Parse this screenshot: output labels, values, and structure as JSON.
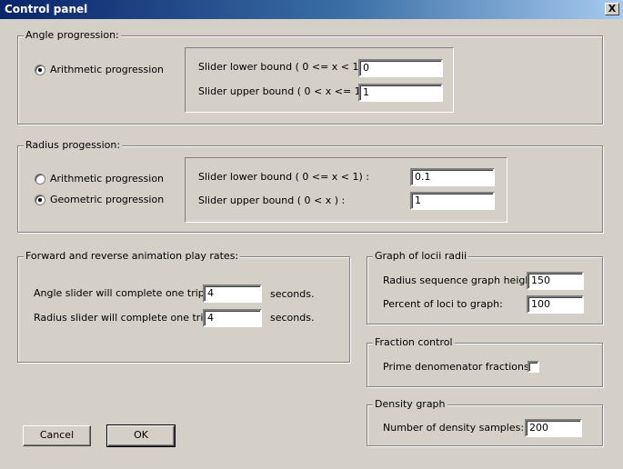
{
  "window": {
    "title": "Control panel",
    "close_label": "X"
  },
  "angle": {
    "legend": "Angle progression:",
    "radio_arith": "Arithmetic progression",
    "lower_label": "Slider lower bound   ( 0 <= x <  1)  :",
    "lower_value": "0",
    "upper_label": "Slider upper bound   ( 0 < x <= 1)  :",
    "upper_value": "1"
  },
  "radius": {
    "legend": "Radius progession:",
    "radio_arith": "Arithmetic progression",
    "radio_geom": "Geometric progression",
    "lower_label": "Slider lower bound   ( 0 <= x <  1)  :",
    "lower_value": "0.1",
    "upper_label": "Slider upper bound   ( 0 < x )  :",
    "upper_value": "1"
  },
  "rates": {
    "legend": "Forward and reverse animation play rates:",
    "angle_label": "Angle slider will complete one trip in",
    "angle_value": "4",
    "angle_unit": "seconds.",
    "radius_label": "Radius slider will complete one trip in",
    "radius_value": "4",
    "radius_unit": "seconds."
  },
  "loci": {
    "legend": "Graph of locii radii",
    "height_label": "Radius sequence graph height:",
    "height_value": "150",
    "percent_label": "Percent of loci to graph:",
    "percent_value": "100"
  },
  "fraction": {
    "legend": "Fraction control",
    "prime_label": "Prime denomenator fractions:",
    "prime_checked": false
  },
  "density": {
    "legend": "Density graph",
    "samples_label": "Number of density samples:",
    "samples_value": "200"
  },
  "buttons": {
    "cancel": "Cancel",
    "ok": "OK"
  }
}
